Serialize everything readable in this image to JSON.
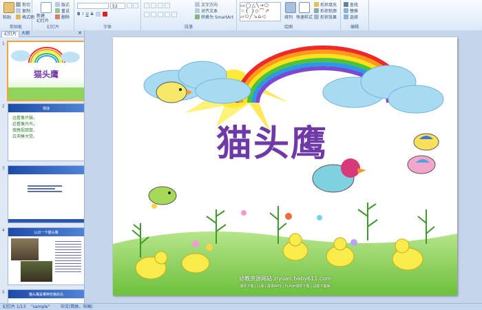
{
  "ribbon": {
    "clipboard": {
      "label": "剪贴板",
      "paste": "粘贴",
      "cut": "剪切",
      "copy": "复制",
      "format_painter": "格式刷"
    },
    "slides": {
      "label": "幻灯片",
      "new_slide": "新建\n幻灯片",
      "layout": "版式",
      "reset": "重设",
      "delete": "删除"
    },
    "font": {
      "label": "字体",
      "size_value": "52"
    },
    "paragraph": {
      "label": "段落",
      "text_direction": "文字方向",
      "align_text": "对齐文本",
      "smartart": "转换为 SmartArt"
    },
    "drawing": {
      "label": "绘图",
      "arrange": "排列",
      "quick_styles": "快速样式",
      "shape_fill": "形状填充",
      "shape_outline": "形状轮廓",
      "shape_effects": "形状效果"
    },
    "editing": {
      "label": "编辑",
      "find": "查找",
      "replace": "替换",
      "select": "选择"
    }
  },
  "panel": {
    "tabs": [
      "幻灯片",
      "大纲"
    ],
    "thumbnails": [
      {
        "num": "1",
        "title": "猫头鹰"
      },
      {
        "num": "2",
        "header": "猜谜",
        "lines": [
          "远看像只猫，",
          "近看像只鸟，",
          "夜晚捉田鼠，",
          "白天睡大觉。"
        ]
      },
      {
        "num": "3"
      },
      {
        "num": "4",
        "header": "认识一下猫头鹰"
      },
      {
        "num": "5",
        "header": "猫头鹰是哪种性格的鸟"
      }
    ]
  },
  "slide": {
    "title": "猫头鹰",
    "website": "幼教资源网站 ziyuan.baby611.com",
    "links": "课件下载 | 儿歌 | 故事MP3 | FLASH课件下载 | 试卷下载等"
  },
  "status": {
    "slide_info": "幻灯片 1/13",
    "theme": "\"sample\"",
    "language": "中文(简体，中国)"
  },
  "colors": {
    "title": "#6f3aa8",
    "accent": "#f7a23b"
  }
}
